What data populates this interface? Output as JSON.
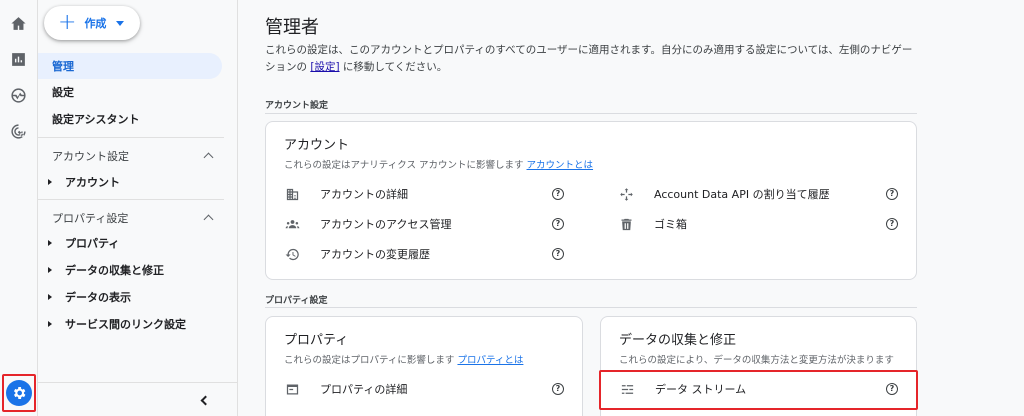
{
  "create_button": {
    "label": "作成"
  },
  "nav": {
    "admin": "管理",
    "settings": "設定",
    "setup_assistant": "設定アシスタント",
    "account_settings": {
      "heading": "アカウント設定",
      "items": [
        "アカウント"
      ]
    },
    "property_settings": {
      "heading": "プロパティ設定",
      "items": [
        "プロパティ",
        "データの収集と修正",
        "データの表示",
        "サービス間のリンク設定"
      ]
    }
  },
  "main": {
    "title": "管理者",
    "description_before": "これらの設定は、このアカウントとプロパティのすべてのユーザーに適用されます。自分にのみ適用する設定については、左側のナビゲーションの ",
    "description_link": "[設定]",
    "description_after": " に移動してください。",
    "account_section_label": "アカウント設定",
    "property_section_label": "プロパティ設定",
    "account_card": {
      "title": "アカウント",
      "subtitle": "これらの設定はアナリティクス アカウントに影響します",
      "subtitle_link": "アカウントとは",
      "left_items": [
        "アカウントの詳細",
        "アカウントのアクセス管理",
        "アカウントの変更履歴"
      ],
      "right_items": [
        "Account Data API の割り当て履歴",
        "ゴミ箱"
      ]
    },
    "property_card": {
      "title": "プロパティ",
      "subtitle": "これらの設定はプロパティに影響します",
      "subtitle_link": "プロパティとは",
      "items": [
        "プロパティの詳細"
      ]
    },
    "data_card": {
      "title": "データの収集と修正",
      "subtitle": "これらの設定により、データの収集方法と変更方法が決まります",
      "items": [
        "データ ストリーム"
      ]
    }
  },
  "icons": {
    "rail": [
      "home-icon",
      "reports-icon",
      "explore-icon",
      "advertising-icon",
      "admin-gear-icon"
    ]
  },
  "colors": {
    "accent": "#1a73e8",
    "highlight": "#e5252a",
    "nav_selected_bg": "#e8f0fe"
  }
}
